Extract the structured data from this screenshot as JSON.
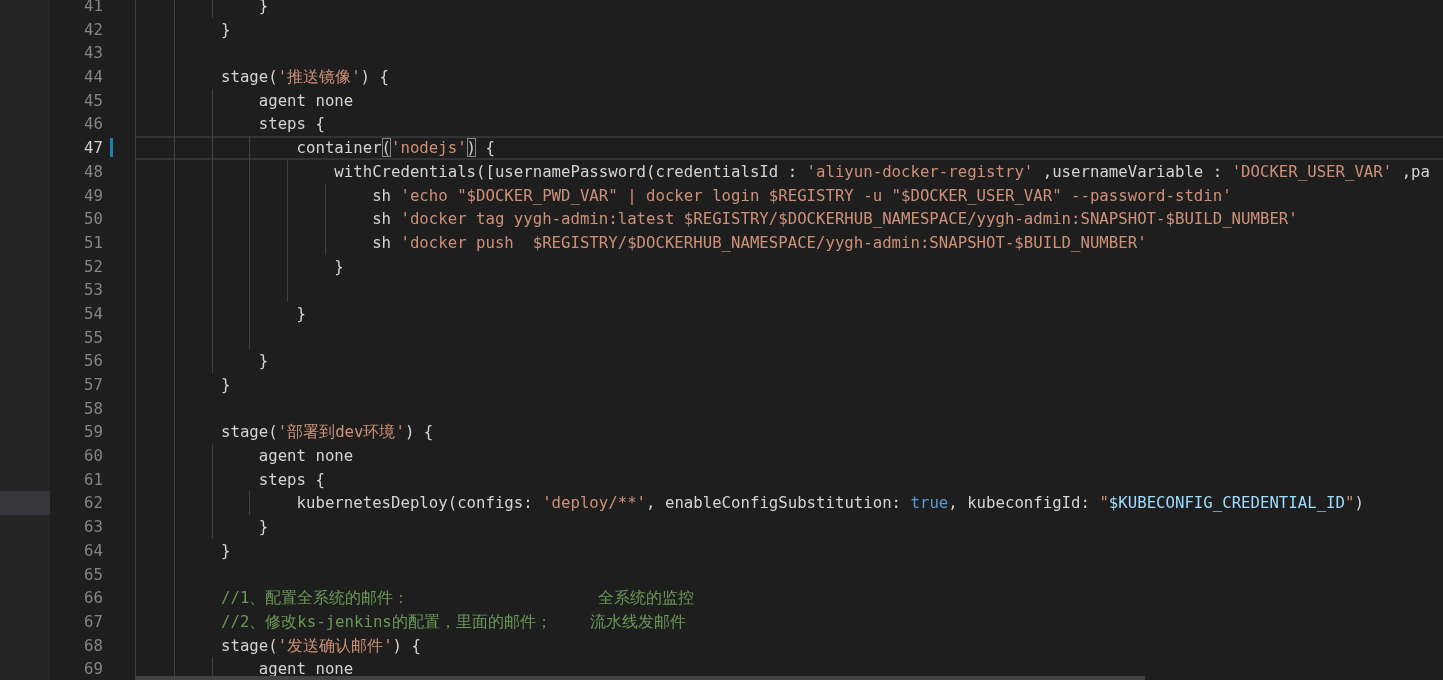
{
  "editor": {
    "lines": [
      {
        "number": "41",
        "active": false,
        "modified": false,
        "explorer_selected": false,
        "tokens": [
          {
            "kind": "plain",
            "text": "            }"
          }
        ]
      },
      {
        "number": "42",
        "active": false,
        "modified": false,
        "explorer_selected": false,
        "tokens": [
          {
            "kind": "plain",
            "text": "        }"
          }
        ]
      },
      {
        "number": "43",
        "active": false,
        "modified": false,
        "explorer_selected": false
      },
      {
        "number": "44",
        "active": false,
        "modified": false,
        "explorer_selected": false,
        "tokens": [
          {
            "kind": "plain",
            "text": "        stage("
          },
          {
            "kind": "string",
            "text": "'推送镜像'"
          },
          {
            "kind": "plain",
            "text": ") {"
          }
        ]
      },
      {
        "number": "45",
        "active": false,
        "modified": false,
        "explorer_selected": false,
        "tokens": [
          {
            "kind": "plain",
            "text": "            agent none"
          }
        ]
      },
      {
        "number": "46",
        "active": false,
        "modified": false,
        "explorer_selected": false,
        "tokens": [
          {
            "kind": "plain",
            "text": "            steps {"
          }
        ]
      },
      {
        "number": "47",
        "active": true,
        "modified": true,
        "explorer_selected": false,
        "tokens": [
          {
            "kind": "plain",
            "text": "                container"
          },
          {
            "kind": "bracket",
            "text": "("
          },
          {
            "kind": "string",
            "text": "'nodejs'"
          },
          {
            "kind": "bracket",
            "text": ")"
          },
          {
            "kind": "plain",
            "text": " {"
          }
        ]
      },
      {
        "number": "48",
        "active": false,
        "modified": false,
        "explorer_selected": false,
        "tokens": [
          {
            "kind": "plain",
            "text": "                    withCredentials([usernamePassword(credentialsId : "
          },
          {
            "kind": "string",
            "text": "'aliyun-docker-registry'"
          },
          {
            "kind": "plain",
            "text": " ,usernameVariable : "
          },
          {
            "kind": "string",
            "text": "'DOCKER_USER_VAR'"
          },
          {
            "kind": "plain",
            "text": " ,pa"
          }
        ]
      },
      {
        "number": "49",
        "active": false,
        "modified": false,
        "explorer_selected": false,
        "tokens": [
          {
            "kind": "plain",
            "text": "                        sh "
          },
          {
            "kind": "string",
            "text": "'echo \"$DOCKER_PWD_VAR\" | docker login $REGISTRY -u \"$DOCKER_USER_VAR\" --password-stdin'"
          }
        ]
      },
      {
        "number": "50",
        "active": false,
        "modified": false,
        "explorer_selected": false,
        "tokens": [
          {
            "kind": "plain",
            "text": "                        sh "
          },
          {
            "kind": "string",
            "text": "'docker tag yygh-admin:latest $REGISTRY/$DOCKERHUB_NAMESPACE/yygh-admin:SNAPSHOT-$BUILD_NUMBER'"
          }
        ]
      },
      {
        "number": "51",
        "active": false,
        "modified": false,
        "explorer_selected": false,
        "tokens": [
          {
            "kind": "plain",
            "text": "                        sh "
          },
          {
            "kind": "string",
            "text": "'docker push  $REGISTRY/$DOCKERHUB_NAMESPACE/yygh-admin:SNAPSHOT-$BUILD_NUMBER'"
          }
        ]
      },
      {
        "number": "52",
        "active": false,
        "modified": false,
        "explorer_selected": false,
        "tokens": [
          {
            "kind": "plain",
            "text": "                    }"
          }
        ]
      },
      {
        "number": "53",
        "active": false,
        "modified": false,
        "explorer_selected": false
      },
      {
        "number": "54",
        "active": false,
        "modified": false,
        "explorer_selected": false,
        "tokens": [
          {
            "kind": "plain",
            "text": "                }"
          }
        ]
      },
      {
        "number": "55",
        "active": false,
        "modified": false,
        "explorer_selected": false
      },
      {
        "number": "56",
        "active": false,
        "modified": false,
        "explorer_selected": false,
        "tokens": [
          {
            "kind": "plain",
            "text": "            }"
          }
        ]
      },
      {
        "number": "57",
        "active": false,
        "modified": false,
        "explorer_selected": false,
        "tokens": [
          {
            "kind": "plain",
            "text": "        }"
          }
        ]
      },
      {
        "number": "58",
        "active": false,
        "modified": false,
        "explorer_selected": false
      },
      {
        "number": "59",
        "active": false,
        "modified": false,
        "explorer_selected": false,
        "tokens": [
          {
            "kind": "plain",
            "text": "        stage("
          },
          {
            "kind": "string",
            "text": "'部署到dev环境'"
          },
          {
            "kind": "plain",
            "text": ") {"
          }
        ]
      },
      {
        "number": "60",
        "active": false,
        "modified": false,
        "explorer_selected": false,
        "tokens": [
          {
            "kind": "plain",
            "text": "            agent none"
          }
        ]
      },
      {
        "number": "61",
        "active": false,
        "modified": false,
        "explorer_selected": false,
        "tokens": [
          {
            "kind": "plain",
            "text": "            steps {"
          }
        ]
      },
      {
        "number": "62",
        "active": false,
        "modified": false,
        "explorer_selected": true,
        "tokens": [
          {
            "kind": "plain",
            "text": "                kubernetesDeploy(configs: "
          },
          {
            "kind": "string",
            "text": "'deploy/**'"
          },
          {
            "kind": "plain",
            "text": ", enableConfigSubstitution: "
          },
          {
            "kind": "keyword",
            "text": "true"
          },
          {
            "kind": "plain",
            "text": ", kubeconfigId: "
          },
          {
            "kind": "string",
            "text": "\""
          },
          {
            "kind": "variable",
            "text": "$KUBECONFIG_CREDENTIAL_ID"
          },
          {
            "kind": "string",
            "text": "\""
          },
          {
            "kind": "plain",
            "text": ")"
          }
        ]
      },
      {
        "number": "63",
        "active": false,
        "modified": false,
        "explorer_selected": false,
        "tokens": [
          {
            "kind": "plain",
            "text": "            }"
          }
        ]
      },
      {
        "number": "64",
        "active": false,
        "modified": false,
        "explorer_selected": false,
        "tokens": [
          {
            "kind": "plain",
            "text": "        }"
          }
        ]
      },
      {
        "number": "65",
        "active": false,
        "modified": false,
        "explorer_selected": false
      },
      {
        "number": "66",
        "active": false,
        "modified": false,
        "explorer_selected": false,
        "tokens": [
          {
            "kind": "comment",
            "text": "        //1、配置全系统的邮件：                    全系统的监控"
          }
        ]
      },
      {
        "number": "67",
        "active": false,
        "modified": false,
        "explorer_selected": false,
        "tokens": [
          {
            "kind": "comment",
            "text": "        //2、修改ks-jenkins的配置，里面的邮件；    流水线发邮件"
          }
        ]
      },
      {
        "number": "68",
        "active": false,
        "modified": false,
        "explorer_selected": false,
        "tokens": [
          {
            "kind": "plain",
            "text": "        stage("
          },
          {
            "kind": "string",
            "text": "'发送确认邮件'"
          },
          {
            "kind": "plain",
            "text": ") {"
          }
        ]
      },
      {
        "number": "69",
        "active": false,
        "modified": false,
        "explorer_selected": false,
        "tokens": [
          {
            "kind": "plain",
            "text": "            agent none"
          }
        ]
      }
    ]
  }
}
